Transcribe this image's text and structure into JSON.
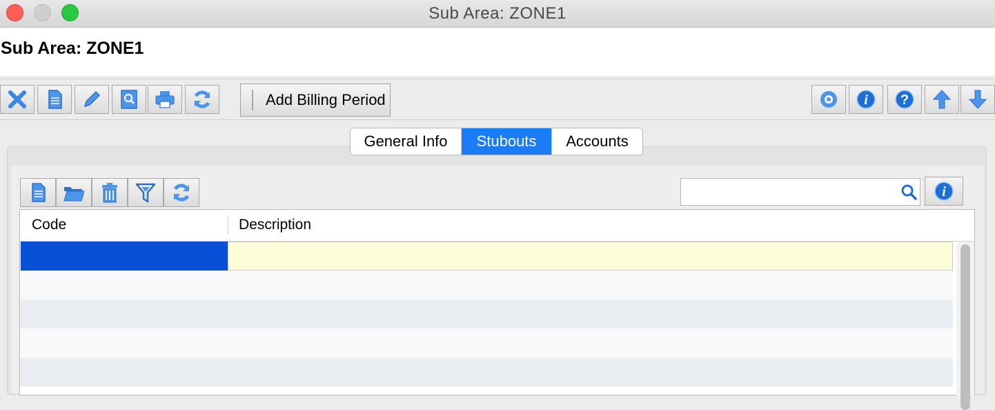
{
  "window": {
    "title": "Sub Area: ZONE1"
  },
  "header": {
    "title": "Sub Area: ZONE1"
  },
  "toolbar": {
    "left_buttons": [
      "close-icon",
      "new-document-icon",
      "edit-icon",
      "preview-search-icon",
      "print-icon",
      "refresh-icon"
    ],
    "add_billing_period": "Add Billing Period",
    "right_buttons": [
      "settings-icon",
      "info-icon",
      "help-icon",
      "arrow-up-icon",
      "arrow-down-icon"
    ]
  },
  "tabs": [
    {
      "label": "General Info",
      "active": false
    },
    {
      "label": "Stubouts",
      "active": true
    },
    {
      "label": "Accounts",
      "active": false
    }
  ],
  "grid_toolbar": {
    "buttons": [
      "new-icon",
      "open-folder-icon",
      "delete-icon",
      "filter-icon",
      "refresh-icon"
    ],
    "search": {
      "value": "",
      "placeholder": ""
    }
  },
  "table": {
    "columns": [
      "Code",
      "Description"
    ],
    "rows": [
      {
        "code": "",
        "description": "",
        "selected": true
      },
      {
        "code": "",
        "description": ""
      },
      {
        "code": "",
        "description": ""
      },
      {
        "code": "",
        "description": ""
      },
      {
        "code": "",
        "description": ""
      }
    ]
  },
  "colors": {
    "accent": "#1a7cf6",
    "selection": "#0a4fd8",
    "edit_row": "#fdfed9"
  }
}
